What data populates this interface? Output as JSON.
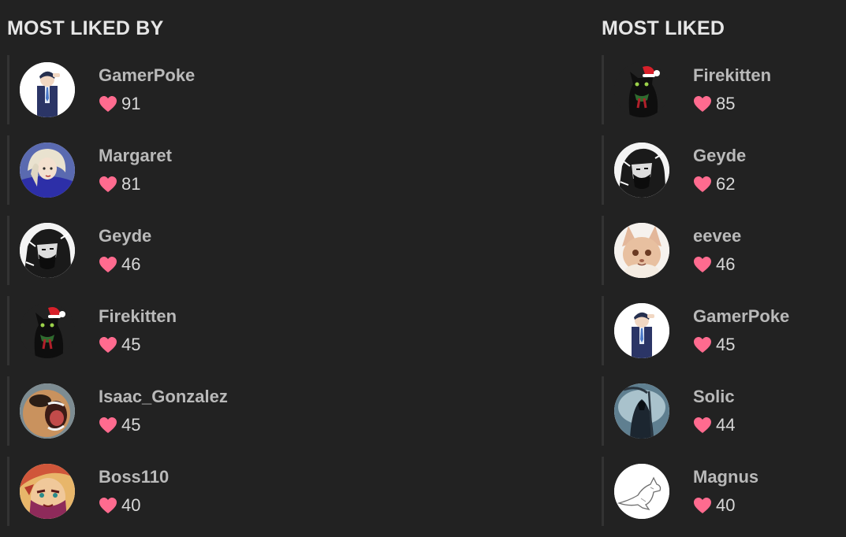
{
  "accent_heart_color": "#ff6b8f",
  "most_liked_by": {
    "title": "MOST LIKED BY",
    "users": [
      {
        "name": "GamerPoke",
        "likes": "91",
        "avatar_icon": "suited-man-avatar"
      },
      {
        "name": "Margaret",
        "likes": "81",
        "avatar_icon": "blonde-woman-avatar"
      },
      {
        "name": "Geyde",
        "likes": "46",
        "avatar_icon": "bw-warrior-avatar"
      },
      {
        "name": "Firekitten",
        "likes": "45",
        "avatar_icon": "black-cat-santa-hat-avatar"
      },
      {
        "name": "Isaac_Gonzalez",
        "likes": "45",
        "avatar_icon": "screaming-face-avatar"
      },
      {
        "name": "Boss110",
        "likes": "40",
        "avatar_icon": "anime-character-avatar"
      }
    ]
  },
  "most_liked": {
    "title": "MOST LIKED",
    "users": [
      {
        "name": "Firekitten",
        "likes": "85",
        "avatar_icon": "black-cat-santa-hat-avatar"
      },
      {
        "name": "Geyde",
        "likes": "62",
        "avatar_icon": "bw-warrior-avatar"
      },
      {
        "name": "eevee",
        "likes": "46",
        "avatar_icon": "fox-creature-avatar"
      },
      {
        "name": "GamerPoke",
        "likes": "45",
        "avatar_icon": "suited-man-avatar"
      },
      {
        "name": "Solic",
        "likes": "44",
        "avatar_icon": "dark-reaper-avatar"
      },
      {
        "name": "Magnus",
        "likes": "40",
        "avatar_icon": "kangaroo-sketch-avatar"
      }
    ]
  }
}
